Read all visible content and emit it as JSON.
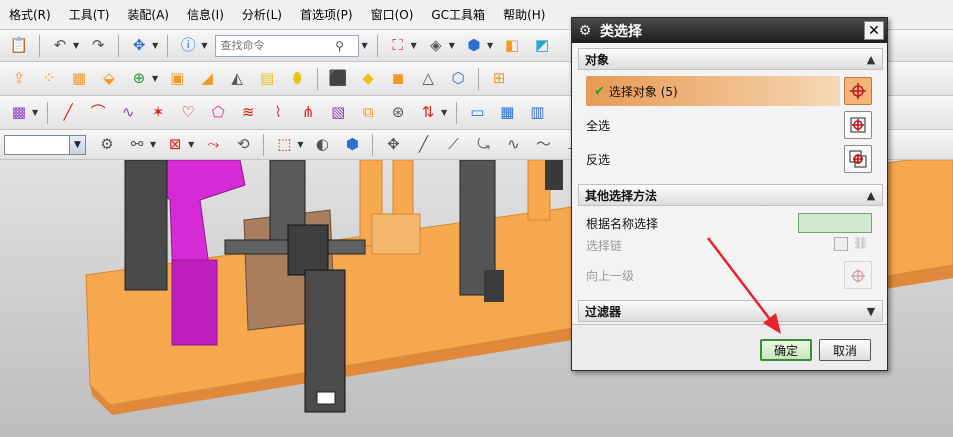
{
  "menu": [
    "格式(R)",
    "工具(T)",
    "装配(A)",
    "信息(I)",
    "分析(L)",
    "首选项(P)",
    "窗口(O)",
    "GC工具箱",
    "帮助(H)"
  ],
  "toolbar": {
    "search_placeholder": "查找命令",
    "search_icon": "search-icon"
  },
  "icons": {
    "row1": [
      "paste-icon",
      "undo-icon",
      "redo-icon",
      "move-icon",
      "info-icon",
      "fit-view-icon",
      "shaded-view-icon",
      "box-view-icon",
      "layer-icon",
      "wcs-icon"
    ],
    "row2": [
      "extrude-icon",
      "pattern-icon",
      "block-assembly-icon",
      "component-icon",
      "add-component-icon",
      "box-icon",
      "blend-icon",
      "chamfer-icon",
      "shell-icon",
      "cylinder-icon",
      "cube-icon",
      "face-icon",
      "orange-face-icon",
      "pyramid-icon",
      "wire-icon",
      "assembly-new-icon"
    ],
    "row3": [
      "text-icon",
      "line-icon",
      "arc-icon",
      "spline-icon",
      "point-icon",
      "offset-curve-icon",
      "project-icon",
      "bridge-icon",
      "ruled-icon",
      "join-icon",
      "mesh-icon",
      "through-curves-icon",
      "studio-icon",
      "surface-icon",
      "patch-icon",
      "table-icon",
      "report-icon"
    ],
    "row4": [
      "view-orient-icon",
      "snap-icon",
      "filter-icon",
      "select-region-icon",
      "move-point-icon",
      "rotate-icon",
      "line-snap-icon",
      "curve-snap-icon",
      "tangent-icon",
      "circle-snap-icon",
      "center-snap-icon",
      "plus-snap-icon",
      "cross-snap-icon"
    ]
  },
  "dialog": {
    "title": "类选择",
    "sections": {
      "object": "对象",
      "other": "其他选择方法",
      "filter": "过滤器"
    },
    "rows": {
      "select_objects": "选择对象 (5)",
      "select_all": "全选",
      "invert": "反选",
      "by_name": "根据名称选择",
      "chain": "选择链",
      "up_level": "向上一级"
    },
    "buttons": {
      "ok": "确定",
      "cancel": "取消"
    }
  },
  "colors": {
    "title_bar": "#2a2a2a",
    "highlight": "#e79a54",
    "ok_border": "#3a8b3a",
    "annotation_arrow": "#e8222a",
    "part_orange": "#f6a84e",
    "part_magenta": "#d62ad6",
    "part_dark": "#4a4a4a"
  }
}
